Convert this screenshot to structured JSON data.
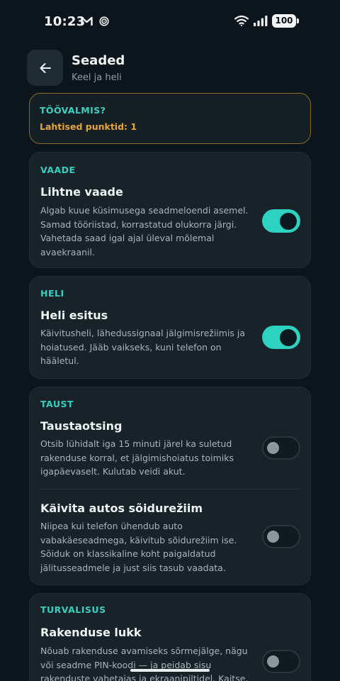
{
  "status_bar": {
    "time": "10:23",
    "battery": "100"
  },
  "header": {
    "back_icon": "arrow-left-icon",
    "title": "Seaded",
    "subtitle": "Keel ja heli"
  },
  "ready_card": {
    "title": "TÖÖVALMIS?",
    "line": "Lahtised punktid: 1",
    "accent": "#e6a43a"
  },
  "sections": {
    "view": {
      "category": "VAADE",
      "item_title": "Lihtne vaade",
      "item_desc": "Algab kuue küsimusega seadmeloendi asemel. Samad tööriistad, korrastatud olukorra järgi. Vahetada saad igal ajal üleval mõlemal avaekraanil.",
      "enabled": true
    },
    "sound": {
      "category": "HELI",
      "item_title": "Heli esitus",
      "item_desc": "Käivitusheli, lähedussignaal jälgimisrežiimis ja hoiatused. Jääb vaikseks, kuni telefon on hääletul.",
      "enabled": true
    },
    "background": {
      "category": "TAUST",
      "items": [
        {
          "title": "Taustaotsing",
          "desc": "Otsib lühidalt iga 15 minuti järel ka suletud rakenduse korral, et jälgimishoiatus toimiks igapäevaselt. Kulutab veidi akut.",
          "enabled": false
        },
        {
          "title": "Käivita autos sõidurežiim",
          "desc": "Niipea kui telefon ühendub auto vabakäeseadmega, käivitub sõidurežiim ise. Sõiduk on klassikaline koht paigaldatud jälitusseadmele ja just siis tasub vaadata.",
          "enabled": false
        }
      ]
    },
    "security": {
      "category": "TURVALISUS",
      "item_title": "Rakenduse lukk",
      "item_desc": "Nõuab rakenduse avamiseks sõrmejälge, nägu või seadme PIN-koodi — ja peidab sisu rakenduste vahetajas ja ekraanipiltidel. Kaitse.",
      "enabled": false
    }
  },
  "colors": {
    "accent_teal": "#2dd2c0",
    "background": "#0b151b",
    "card": "#172329"
  }
}
